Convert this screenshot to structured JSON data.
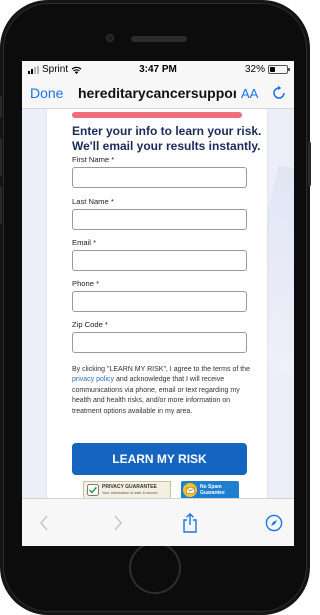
{
  "status_bar": {
    "carrier": "Sprint",
    "time": "3:47 PM",
    "battery_percent": "32%",
    "battery_level": 0.32
  },
  "browser": {
    "done_label": "Done",
    "url": "hereditarycancersupport",
    "text_size_label": "AA"
  },
  "form": {
    "heading": "Enter your info to learn your risk. We'll email your results instantly.",
    "fields": [
      {
        "label": "First Name *"
      },
      {
        "label": "Last Name *"
      },
      {
        "label": "Email *"
      },
      {
        "label": "Phone *"
      },
      {
        "label": "Zip Code *"
      }
    ],
    "disclaimer_before": "By clicking \"LEARN MY RISK\", I agree to the terms of the ",
    "privacy_link": "privacy policy",
    "disclaimer_after": " and acknowledge that I will receive communications via phone, email or text regarding my health and health risks, and/or more information on treatment options available in my area.",
    "submit_label": "LEARN MY RISK"
  },
  "badges": {
    "privacy_title": "PRIVACY GUARANTEE",
    "privacy_subtitle": "Your information is safe & secure",
    "nospam_line1": "No Spam",
    "nospam_line2": "Guarantee"
  },
  "toolbar": {
    "icons": [
      "back-arrow-icon",
      "forward-arrow-icon",
      "share-icon",
      "compass-icon"
    ]
  },
  "colors": {
    "link_blue": "#1a73e8",
    "heading_navy": "#1c2a5c",
    "cta_blue": "#1565c0",
    "accent_pink": "#ee6f7b"
  }
}
